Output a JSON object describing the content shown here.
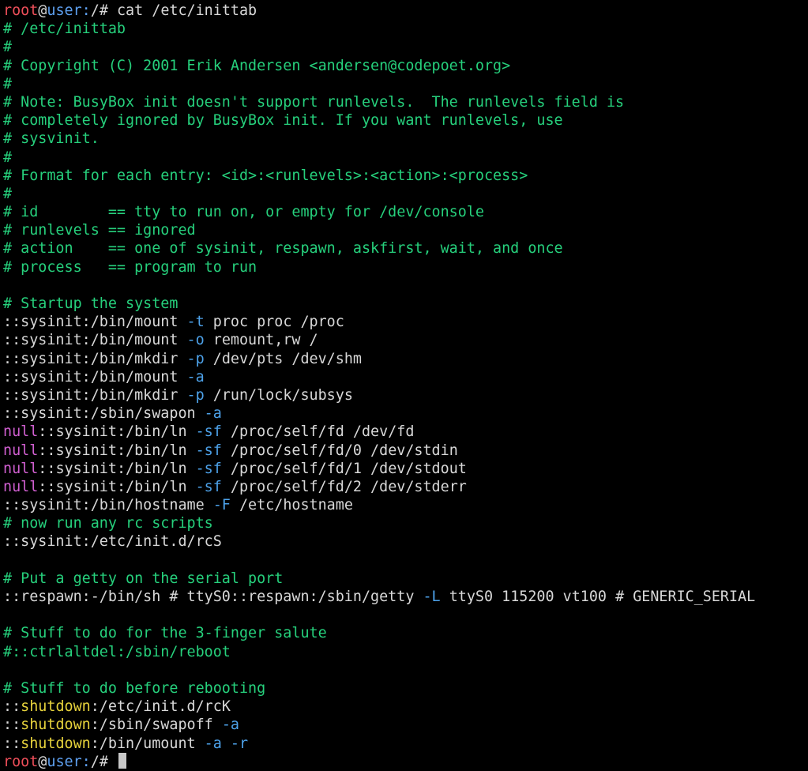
{
  "colors": {
    "background": "#000000",
    "default": "#d8d8d8",
    "comment": "#26d07c",
    "prompt_user": "#ef4f5a",
    "prompt_host": "#5ea0f0",
    "option": "#4da2ea",
    "null_keyword": "#d05fd0",
    "shutdown_keyword": "#e6d23c"
  },
  "terminal": {
    "lines": [
      [
        {
          "t": "root",
          "c": "prompt_user"
        },
        {
          "t": "@",
          "c": "default"
        },
        {
          "t": "user:",
          "c": "prompt_host"
        },
        {
          "t": "/# cat /etc/inittab",
          "c": "default"
        }
      ],
      [
        {
          "t": "# /etc/inittab",
          "c": "comment"
        }
      ],
      [
        {
          "t": "#",
          "c": "comment"
        }
      ],
      [
        {
          "t": "# Copyright (C) 2001 Erik Andersen <andersen@codepoet.org>",
          "c": "comment"
        }
      ],
      [
        {
          "t": "#",
          "c": "comment"
        }
      ],
      [
        {
          "t": "# Note: BusyBox init doesn't support runlevels.  The runlevels field is",
          "c": "comment"
        }
      ],
      [
        {
          "t": "# completely ignored by BusyBox init. If you want runlevels, use",
          "c": "comment"
        }
      ],
      [
        {
          "t": "# sysvinit.",
          "c": "comment"
        }
      ],
      [
        {
          "t": "#",
          "c": "comment"
        }
      ],
      [
        {
          "t": "# Format for each entry: <id>:<runlevels>:<action>:<process>",
          "c": "comment"
        }
      ],
      [
        {
          "t": "#",
          "c": "comment"
        }
      ],
      [
        {
          "t": "# id        == tty to run on, or empty for /dev/console",
          "c": "comment"
        }
      ],
      [
        {
          "t": "# runlevels == ignored",
          "c": "comment"
        }
      ],
      [
        {
          "t": "# action    == one of sysinit, respawn, askfirst, wait, and once",
          "c": "comment"
        }
      ],
      [
        {
          "t": "# process   == program to run",
          "c": "comment"
        }
      ],
      [],
      [
        {
          "t": "# Startup the system",
          "c": "comment"
        }
      ],
      [
        {
          "t": "::sysinit:/bin/mount ",
          "c": "default"
        },
        {
          "t": "-t",
          "c": "option"
        },
        {
          "t": " proc proc /proc",
          "c": "default"
        }
      ],
      [
        {
          "t": "::sysinit:/bin/mount ",
          "c": "default"
        },
        {
          "t": "-o",
          "c": "option"
        },
        {
          "t": " remount,rw /",
          "c": "default"
        }
      ],
      [
        {
          "t": "::sysinit:/bin/mkdir ",
          "c": "default"
        },
        {
          "t": "-p",
          "c": "option"
        },
        {
          "t": " /dev/pts /dev/shm",
          "c": "default"
        }
      ],
      [
        {
          "t": "::sysinit:/bin/mount ",
          "c": "default"
        },
        {
          "t": "-a",
          "c": "option"
        }
      ],
      [
        {
          "t": "::sysinit:/bin/mkdir ",
          "c": "default"
        },
        {
          "t": "-p",
          "c": "option"
        },
        {
          "t": " /run/lock/subsys",
          "c": "default"
        }
      ],
      [
        {
          "t": "::sysinit:/sbin/swapon ",
          "c": "default"
        },
        {
          "t": "-a",
          "c": "option"
        }
      ],
      [
        {
          "t": "null",
          "c": "null_keyword"
        },
        {
          "t": "::sysinit:/bin/ln ",
          "c": "default"
        },
        {
          "t": "-sf",
          "c": "option"
        },
        {
          "t": " /proc/self/fd /dev/fd",
          "c": "default"
        }
      ],
      [
        {
          "t": "null",
          "c": "null_keyword"
        },
        {
          "t": "::sysinit:/bin/ln ",
          "c": "default"
        },
        {
          "t": "-sf",
          "c": "option"
        },
        {
          "t": " /proc/self/fd/0 /dev/stdin",
          "c": "default"
        }
      ],
      [
        {
          "t": "null",
          "c": "null_keyword"
        },
        {
          "t": "::sysinit:/bin/ln ",
          "c": "default"
        },
        {
          "t": "-sf",
          "c": "option"
        },
        {
          "t": " /proc/self/fd/1 /dev/stdout",
          "c": "default"
        }
      ],
      [
        {
          "t": "null",
          "c": "null_keyword"
        },
        {
          "t": "::sysinit:/bin/ln ",
          "c": "default"
        },
        {
          "t": "-sf",
          "c": "option"
        },
        {
          "t": " /proc/self/fd/2 /dev/stderr",
          "c": "default"
        }
      ],
      [
        {
          "t": "::sysinit:/bin/hostname ",
          "c": "default"
        },
        {
          "t": "-F",
          "c": "option"
        },
        {
          "t": " /etc/hostname",
          "c": "default"
        }
      ],
      [
        {
          "t": "# now run any rc scripts",
          "c": "comment"
        }
      ],
      [
        {
          "t": "::sysinit:/etc/init.d/rcS",
          "c": "default"
        }
      ],
      [],
      [
        {
          "t": "# Put a getty on the serial port",
          "c": "comment"
        }
      ],
      [
        {
          "t": "::respawn:-/bin/sh # ttyS0::respawn:/sbin/getty ",
          "c": "default"
        },
        {
          "t": "-L",
          "c": "option"
        },
        {
          "t": " ttyS0 115200 vt100 # GENERIC_SERIAL",
          "c": "default"
        }
      ],
      [],
      [
        {
          "t": "# Stuff to do for the 3-finger salute",
          "c": "comment"
        }
      ],
      [
        {
          "t": "#::ctrlaltdel:/sbin/reboot",
          "c": "comment"
        }
      ],
      [],
      [
        {
          "t": "# Stuff to do before rebooting",
          "c": "comment"
        }
      ],
      [
        {
          "t": "::",
          "c": "default"
        },
        {
          "t": "shutdown",
          "c": "shutdown_keyword"
        },
        {
          "t": ":/etc/init.d/rcK",
          "c": "default"
        }
      ],
      [
        {
          "t": "::",
          "c": "default"
        },
        {
          "t": "shutdown",
          "c": "shutdown_keyword"
        },
        {
          "t": ":/sbin/swapoff ",
          "c": "default"
        },
        {
          "t": "-a",
          "c": "option"
        }
      ],
      [
        {
          "t": "::",
          "c": "default"
        },
        {
          "t": "shutdown",
          "c": "shutdown_keyword"
        },
        {
          "t": ":/bin/umount ",
          "c": "default"
        },
        {
          "t": "-a",
          "c": "option"
        },
        {
          "t": " ",
          "c": "default"
        },
        {
          "t": "-r",
          "c": "option"
        }
      ],
      [
        {
          "t": "root",
          "c": "prompt_user"
        },
        {
          "t": "@",
          "c": "default"
        },
        {
          "t": "user:",
          "c": "prompt_host"
        },
        {
          "t": "/# ",
          "c": "default"
        }
      ]
    ]
  }
}
